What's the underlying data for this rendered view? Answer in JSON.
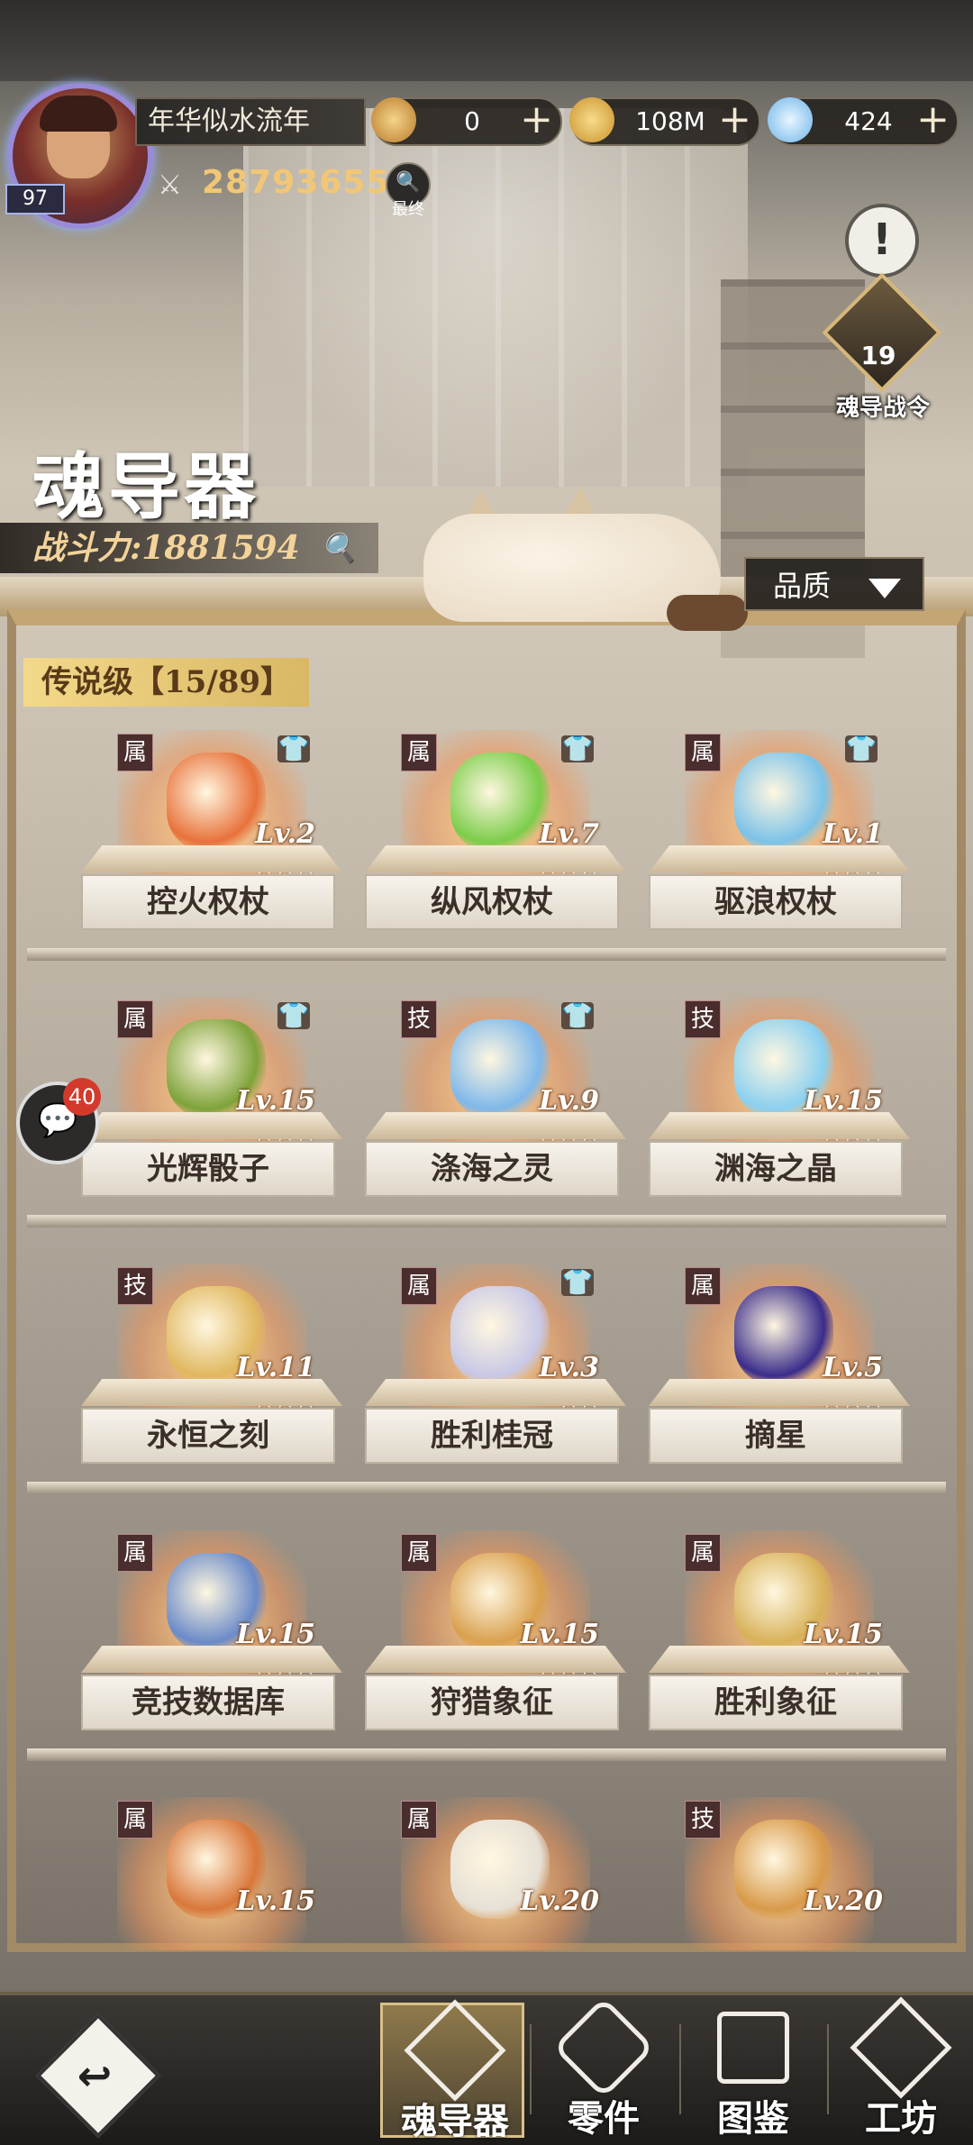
{
  "player": {
    "name": "年华似水流年",
    "level": "97",
    "combat_power": "28793655",
    "search_caption": "最终"
  },
  "resources": [
    {
      "icon": "gold-medal-icon",
      "value": "0",
      "color": "#d9a54a"
    },
    {
      "icon": "coin-icon",
      "value": "108M",
      "color": "#e2b34e"
    },
    {
      "icon": "diamond-icon",
      "value": "424",
      "color": "#8fd0ff"
    }
  ],
  "battle_pass": {
    "level": "19",
    "label": "魂导战令"
  },
  "page": {
    "title": "魂导器",
    "power_label": "战斗力:1881594",
    "quality_filter": "品质"
  },
  "tier": {
    "label": "传说级【15/89】"
  },
  "chat": {
    "count": "40"
  },
  "items": [
    {
      "name": "控火权杖",
      "level": "Lv.2",
      "tag": "属",
      "stars": "★★★",
      "color": "#e8713a"
    },
    {
      "name": "纵风权杖",
      "level": "Lv.7",
      "tag": "属",
      "stars": "★★★",
      "color": "#7ccd4a"
    },
    {
      "name": "驱浪权杖",
      "level": "Lv.1",
      "tag": "属",
      "stars": "★★★",
      "color": "#7cc2e8"
    },
    {
      "name": "光辉骰子",
      "level": "Lv.15",
      "tag": "属",
      "stars": "★★★",
      "color": "#7ea33a"
    },
    {
      "name": "涤海之灵",
      "level": "Lv.9",
      "tag": "技",
      "stars": "★★★",
      "color": "#7fb8ea"
    },
    {
      "name": "渊海之晶",
      "level": "Lv.15",
      "tag": "技",
      "stars": "★★★",
      "color": "#8ad0f0"
    },
    {
      "name": "永恒之刻",
      "level": "Lv.11",
      "tag": "技",
      "stars": "★★★",
      "color": "#e0b860"
    },
    {
      "name": "胜利桂冠",
      "level": "Lv.3",
      "tag": "属",
      "stars": "★★",
      "color": "#c8c8e6"
    },
    {
      "name": "摘星",
      "level": "Lv.5",
      "tag": "属",
      "stars": "★★★",
      "color": "#3a2c8a"
    },
    {
      "name": "竞技数据库",
      "level": "Lv.15",
      "tag": "属",
      "stars": "★★★",
      "color": "#6a8ac8"
    },
    {
      "name": "狩猎象征",
      "level": "Lv.15",
      "tag": "属",
      "stars": "★★★",
      "color": "#d9a04e"
    },
    {
      "name": "胜利象征",
      "level": "Lv.15",
      "tag": "属",
      "stars": "★★★",
      "color": "#d8b25a"
    },
    {
      "name": "",
      "level": "Lv.15",
      "tag": "属",
      "stars": "",
      "color": "#d9773a"
    },
    {
      "name": "",
      "level": "Lv.20",
      "tag": "属",
      "stars": "",
      "color": "#e6e0d6"
    },
    {
      "name": "",
      "level": "Lv.20",
      "tag": "技",
      "stars": "",
      "color": "#d89a4a"
    }
  ],
  "nav": {
    "tabs": [
      {
        "label": "魂导器",
        "icon": "soul-device-icon"
      },
      {
        "label": "零件",
        "icon": "parts-icon"
      },
      {
        "label": "图鉴",
        "icon": "book-icon"
      },
      {
        "label": "工坊",
        "icon": "workshop-icon"
      }
    ]
  }
}
